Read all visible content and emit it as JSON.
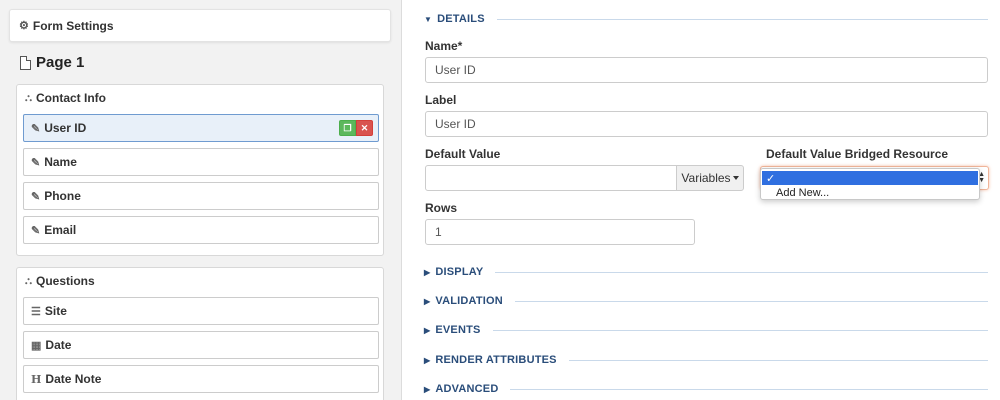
{
  "form_settings": {
    "label": "Form Settings",
    "icon": "gear-icon"
  },
  "page": {
    "title": "Page 1",
    "icon": "page-icon"
  },
  "groups": [
    {
      "title": "Contact Info",
      "icon": "sitemap-icon",
      "fields": [
        {
          "label": "User ID",
          "icon": "edit-icon",
          "selected": true
        },
        {
          "label": "Name",
          "icon": "edit-icon"
        },
        {
          "label": "Phone",
          "icon": "edit-icon"
        },
        {
          "label": "Email",
          "icon": "edit-icon"
        }
      ]
    },
    {
      "title": "Questions",
      "icon": "sitemap-icon",
      "fields": [
        {
          "label": "Site",
          "icon": "list-icon"
        },
        {
          "label": "Date",
          "icon": "calendar-icon"
        },
        {
          "label": "Date Note",
          "icon": "header-icon"
        }
      ]
    }
  ],
  "details": {
    "section_label": "DETAILS",
    "name_label": "Name*",
    "name_value": "User ID",
    "label_label": "Label",
    "label_value": "User ID",
    "default_value_label": "Default Value",
    "default_value": "",
    "variables_button": "Variables",
    "bridged_label": "Default Value Bridged Resource",
    "bridged_options": [
      "",
      "Add New..."
    ],
    "rows_label": "Rows",
    "rows_value": "1"
  },
  "sections": [
    "DISPLAY",
    "VALIDATION",
    "EVENTS",
    "RENDER ATTRIBUTES",
    "ADVANCED"
  ],
  "colors": {
    "accent": "#2a4d7a",
    "selected_field_bg": "#e8f0f9",
    "copy_button": "#5cb85c",
    "delete_button": "#d9534f",
    "dropdown_highlight": "#2f6fe0"
  }
}
